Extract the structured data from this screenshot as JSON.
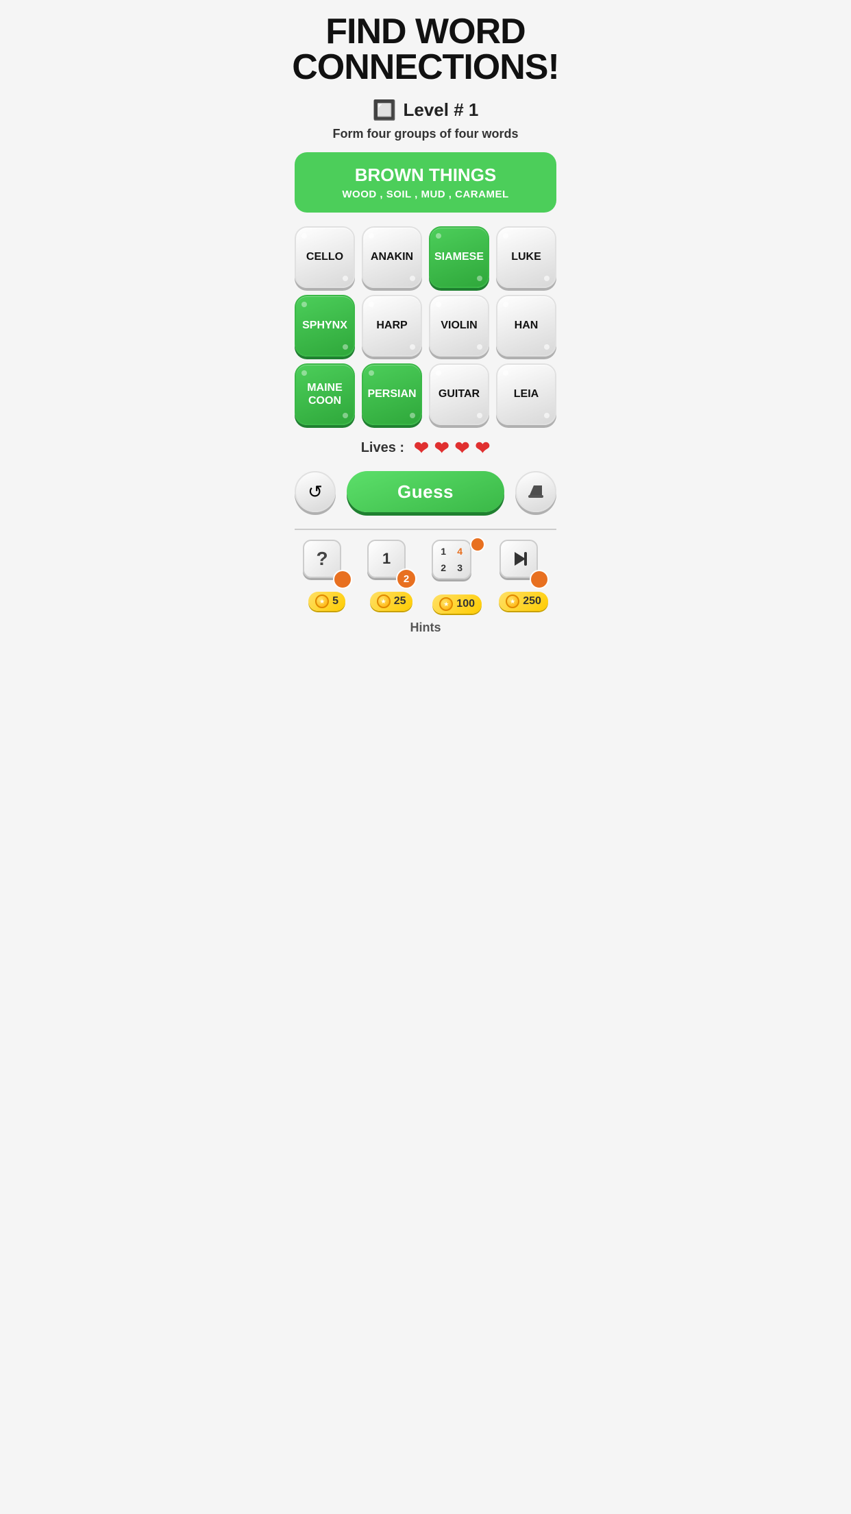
{
  "title": "FIND WORD\nCONNECTIONS!",
  "level": {
    "icon": "🔲",
    "label": "Level # 1"
  },
  "subtitle": "Form four groups of four words",
  "solved_category": {
    "title": "BROWN THINGS",
    "words": "WOOD , SOIL , MUD , CARAMEL"
  },
  "tiles": [
    {
      "label": "CELLO",
      "selected": false
    },
    {
      "label": "ANAKIN",
      "selected": false
    },
    {
      "label": "SIAMESE",
      "selected": true
    },
    {
      "label": "LUKE",
      "selected": false
    },
    {
      "label": "SPHYNX",
      "selected": true
    },
    {
      "label": "HARP",
      "selected": false
    },
    {
      "label": "VIOLIN",
      "selected": false
    },
    {
      "label": "HAN",
      "selected": false
    },
    {
      "label": "MAINE\nCOON",
      "selected": true
    },
    {
      "label": "PERSIAN",
      "selected": true
    },
    {
      "label": "GUITAR",
      "selected": false
    },
    {
      "label": "LEIA",
      "selected": false
    }
  ],
  "lives": {
    "label": "Lives :",
    "count": 4
  },
  "buttons": {
    "shuffle": "↺",
    "guess": "Guess",
    "eraser": "◆"
  },
  "hints": [
    {
      "type": "question",
      "cost": "5"
    },
    {
      "type": "number12",
      "cost": "25"
    },
    {
      "type": "number123",
      "cost": "100"
    },
    {
      "type": "play",
      "cost": "250"
    }
  ],
  "hints_label": "Hints"
}
